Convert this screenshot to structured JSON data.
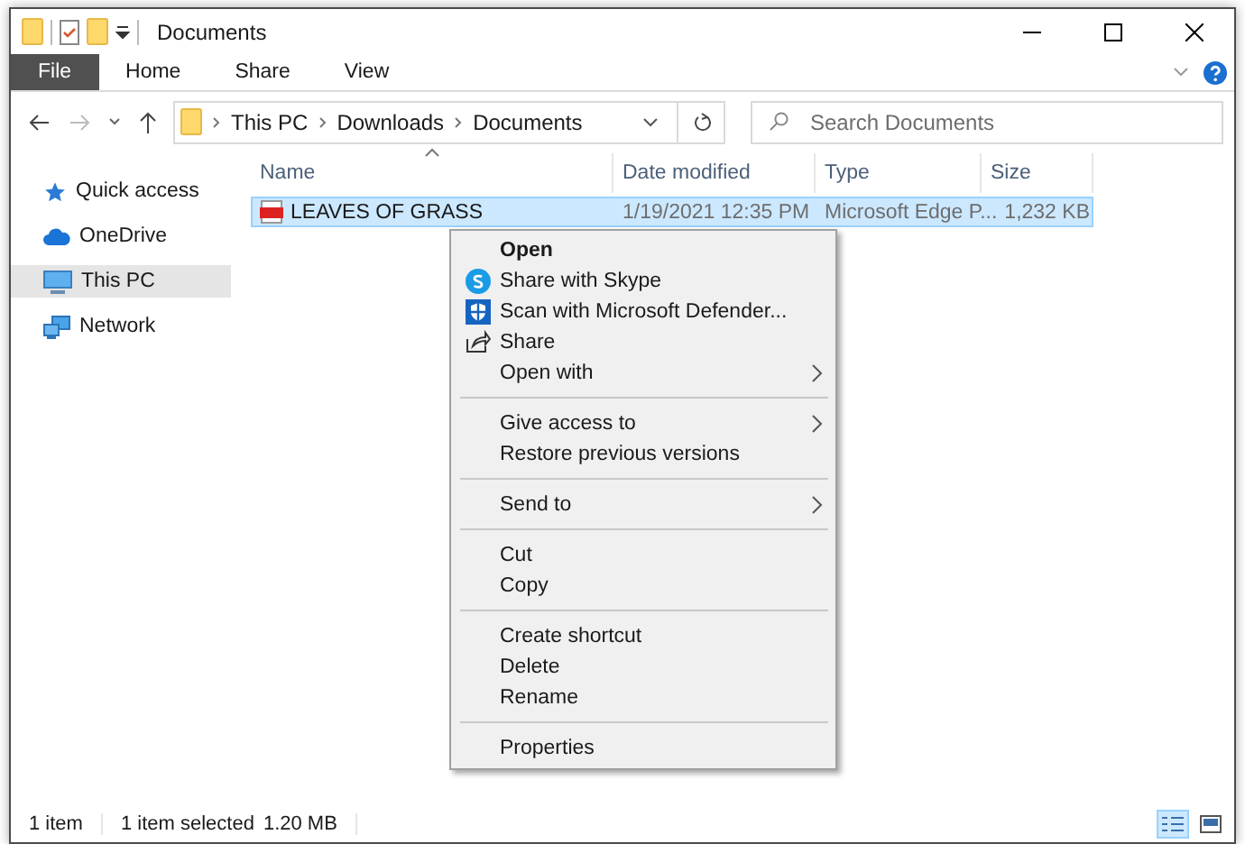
{
  "window": {
    "title": "Documents"
  },
  "ribbon": {
    "tabs": [
      {
        "label": "File",
        "kind": "file"
      },
      {
        "label": "Home",
        "kind": "tab"
      },
      {
        "label": "Share",
        "kind": "tab"
      },
      {
        "label": "View",
        "kind": "tab"
      }
    ]
  },
  "address": {
    "path": [
      "This PC",
      "Downloads",
      "Documents"
    ]
  },
  "search": {
    "placeholder": "Search Documents"
  },
  "sidebar": {
    "items": [
      {
        "label": "Quick access",
        "selected": false
      },
      {
        "label": "OneDrive",
        "selected": false
      },
      {
        "label": "This PC",
        "selected": true
      },
      {
        "label": "Network",
        "selected": false
      }
    ]
  },
  "table": {
    "columns": [
      "Name",
      "Date modified",
      "Type",
      "Size"
    ],
    "rows": [
      {
        "cells": [
          "LEAVES OF GRASS",
          "1/19/2021 12:35 PM",
          "Microsoft Edge P...",
          "1,232 KB"
        ],
        "selected": true
      }
    ]
  },
  "context_menu": {
    "groups": [
      [
        {
          "label": "Open",
          "default": true,
          "submenu": false
        },
        {
          "label": "Share with Skype",
          "default": false,
          "submenu": false
        },
        {
          "label": "Scan with Microsoft Defender...",
          "default": false,
          "submenu": false
        },
        {
          "label": "Share",
          "default": false,
          "submenu": false
        },
        {
          "label": "Open with",
          "default": false,
          "submenu": true
        }
      ],
      [
        {
          "label": "Give access to",
          "default": false,
          "submenu": true
        },
        {
          "label": "Restore previous versions",
          "default": false,
          "submenu": false
        }
      ],
      [
        {
          "label": "Send to",
          "default": false,
          "submenu": true
        }
      ],
      [
        {
          "label": "Cut",
          "default": false,
          "submenu": false
        },
        {
          "label": "Copy",
          "default": false,
          "submenu": false
        }
      ],
      [
        {
          "label": "Create shortcut",
          "default": false,
          "submenu": false
        },
        {
          "label": "Delete",
          "default": false,
          "submenu": false
        },
        {
          "label": "Rename",
          "default": false,
          "submenu": false
        }
      ],
      [
        {
          "label": "Properties",
          "default": false,
          "submenu": false
        }
      ]
    ]
  },
  "status_bar": {
    "items": [
      "1 item",
      "1 item selected",
      "1.20 MB"
    ],
    "view_buttons": [
      {
        "selected": true
      },
      {
        "selected": false
      }
    ]
  }
}
